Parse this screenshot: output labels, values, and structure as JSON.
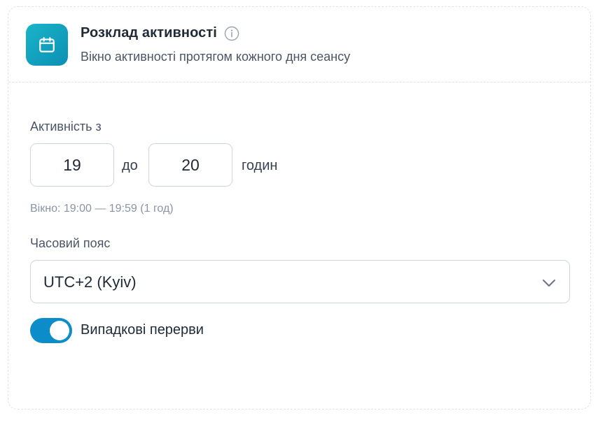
{
  "header": {
    "title": "Розклад активності",
    "subtitle": "Вікно активності протягом кожного дня сеансу",
    "icon": "calendar-icon",
    "info_icon": "info-icon",
    "accent_color": "#12a3c2"
  },
  "activity": {
    "label": "Активність з",
    "from_value": "19",
    "to_label": "до",
    "to_value": "20",
    "unit_label": "годин",
    "window_hint": "Вікно: 19:00 — 19:59 (1 год)"
  },
  "timezone": {
    "label": "Часовий пояс",
    "selected": "UTC+2 (Kyiv)",
    "icon": "chevron-down-icon"
  },
  "random_breaks": {
    "label": "Випадкові перерви",
    "enabled": true,
    "color": "#0c8cc9"
  }
}
